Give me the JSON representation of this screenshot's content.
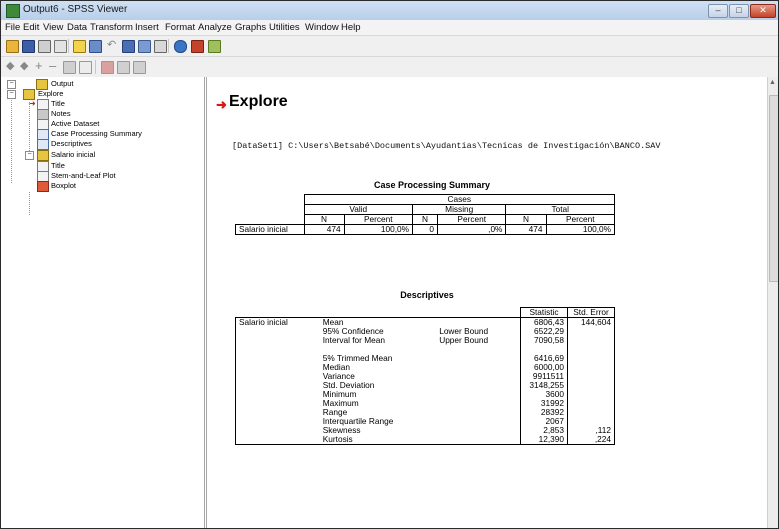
{
  "window": {
    "title": "Output6 - SPSS Viewer",
    "buttons": {
      "minimize": "–",
      "maximize": "□",
      "close": "✕"
    }
  },
  "menu": [
    "File",
    "Edit",
    "View",
    "Data",
    "Transform",
    "Insert",
    "Format",
    "Analyze",
    "Graphs",
    "Utilities",
    "Window",
    "Help"
  ],
  "toolbar1": {
    "icons": [
      "open-icon",
      "save-icon",
      "print-icon",
      "print-preview-icon",
      "export-icon",
      "dialog-recall-icon",
      "undo-icon",
      "goto-data-icon",
      "variables-icon",
      "insert-output-icon",
      "use-sets-icon",
      "select-last-output-icon",
      "designate-window-icon"
    ]
  },
  "toolbar2": {
    "icons": [
      "promote-icon",
      "demote-icon",
      "expand-icon",
      "collapse-icon",
      "show-icon",
      "hide-icon",
      "insert-heading-icon",
      "insert-title-icon",
      "insert-text-icon"
    ]
  },
  "outline": {
    "items": [
      {
        "label": "Output",
        "icon": "book-icon"
      },
      {
        "label": "Explore",
        "icon": "book-icon"
      },
      {
        "label": "Title",
        "icon": "title-page-icon"
      },
      {
        "label": "Notes",
        "icon": "notes-page-icon"
      },
      {
        "label": "Active Dataset",
        "icon": "page-icon"
      },
      {
        "label": "Case Processing Summary",
        "icon": "table-icon"
      },
      {
        "label": "Descriptives",
        "icon": "table-icon"
      },
      {
        "label": "Salario inicial",
        "icon": "book-icon"
      },
      {
        "label": "Title",
        "icon": "page-icon"
      },
      {
        "label": "Stem-and-Leaf Plot",
        "icon": "page-icon"
      },
      {
        "label": "Boxplot",
        "icon": "boxplot-icon"
      }
    ]
  },
  "content": {
    "heading": "Explore",
    "dataset_line": "[DataSet1] C:\\Users\\Betsabé\\Documents\\Ayudantias\\Tecnicas de Investigación\\BANCO.SAV",
    "case_summary": {
      "title": "Case Processing Summary",
      "cases_label": "Cases",
      "groups": [
        "Valid",
        "Missing",
        "Total"
      ],
      "subheaders": [
        "N",
        "Percent",
        "N",
        "Percent",
        "N",
        "Percent"
      ],
      "row_label": "Salario inicial",
      "values": [
        "474",
        "100,0%",
        "0",
        ",0%",
        "474",
        "100,0%"
      ]
    },
    "descriptives": {
      "title": "Descriptives",
      "col_statistic": "Statistic",
      "col_stderr": "Std. Error",
      "variable": "Salario inicial",
      "rows": [
        {
          "label": "Mean",
          "sub": "",
          "stat": "6806,43",
          "se": "144,604"
        },
        {
          "label": "95% Confidence",
          "sub": "Lower Bound",
          "stat": "6522,29",
          "se": ""
        },
        {
          "label": "Interval for Mean",
          "sub": "Upper Bound",
          "stat": "7090,58",
          "se": ""
        },
        {
          "label": "",
          "sub": "",
          "stat": "",
          "se": ""
        },
        {
          "label": "5% Trimmed Mean",
          "sub": "",
          "stat": "6416,69",
          "se": ""
        },
        {
          "label": "Median",
          "sub": "",
          "stat": "6000,00",
          "se": ""
        },
        {
          "label": "Variance",
          "sub": "",
          "stat": "9911511",
          "se": ""
        },
        {
          "label": "Std. Deviation",
          "sub": "",
          "stat": "3148,255",
          "se": ""
        },
        {
          "label": "Minimum",
          "sub": "",
          "stat": "3600",
          "se": ""
        },
        {
          "label": "Maximum",
          "sub": "",
          "stat": "31992",
          "se": ""
        },
        {
          "label": "Range",
          "sub": "",
          "stat": "28392",
          "se": ""
        },
        {
          "label": "Interquartile Range",
          "sub": "",
          "stat": "2067",
          "se": ""
        },
        {
          "label": "Skewness",
          "sub": "",
          "stat": "2,853",
          "se": ",112"
        },
        {
          "label": "Kurtosis",
          "sub": "",
          "stat": "12,390",
          "se": ",224"
        }
      ]
    }
  },
  "colors": {
    "title_arrow": "#d51a12",
    "titlebar": "#c4d7ee"
  }
}
